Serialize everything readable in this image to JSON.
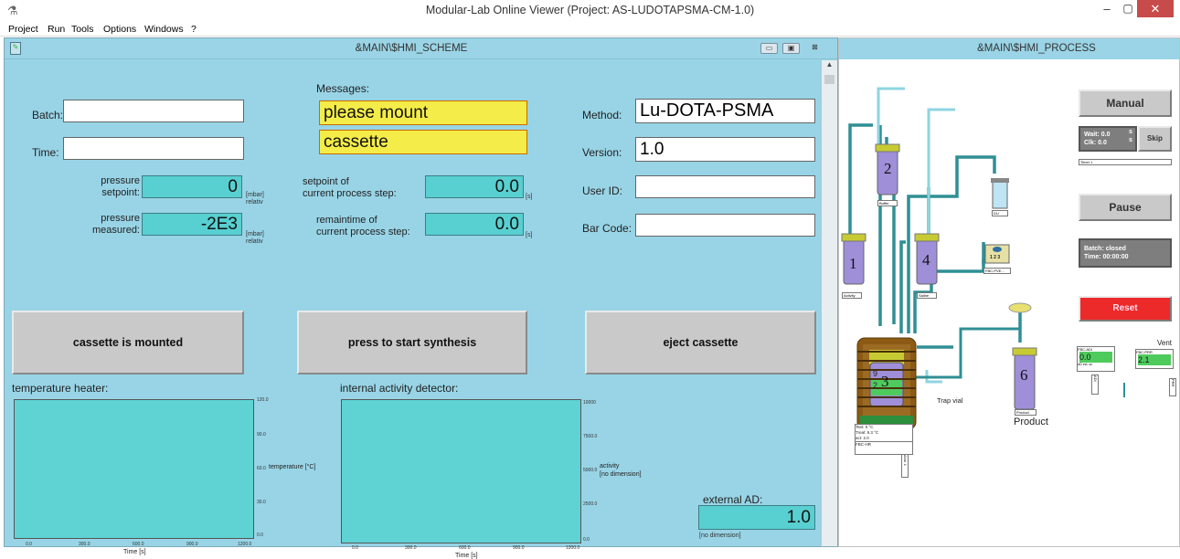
{
  "window": {
    "title": "Modular-Lab Online Viewer   (Project: AS-LUDOTAPSMA-CM-1.0)",
    "close": "✕",
    "minimize": "‒",
    "maximize": "▢"
  },
  "menu": [
    "Project",
    "Run",
    "Tools",
    "Options",
    "Windows",
    "?"
  ],
  "scheme": {
    "title": "&MAIN\\$HMI_SCHEME",
    "batch_label": "Batch:",
    "batch_value": "",
    "time_label": "Time:",
    "time_value": "",
    "messages_label": "Messages:",
    "message_line1": "please mount",
    "message_line2": "cassette",
    "method_label": "Method:",
    "method_value": "Lu-DOTA-PSMA",
    "version_label": "Version:",
    "version_value": "1.0",
    "userid_label": "User ID:",
    "userid_value": "",
    "barcode_label": "Bar Code:",
    "barcode_value": "",
    "pressure_setpoint_label1": "pressure",
    "pressure_setpoint_label2": "setpoint:",
    "pressure_setpoint_value": "0",
    "pressure_measured_label1": "pressure",
    "pressure_measured_label2": "measured:",
    "pressure_measured_value": "-2E3",
    "unit_mbar": "[mbar]",
    "unit_relativ": "relativ",
    "setpoint_step_label1": "setpoint of",
    "setpoint_step_label2": "current process step:",
    "setpoint_step_value": "0.0",
    "remaintime_label1": "remaintime of",
    "remaintime_label2": "current process step:",
    "remaintime_value": "0.0",
    "unit_s": "[s]",
    "btn_mounted": "cassette is mounted",
    "btn_start": "press to start synthesis",
    "btn_eject": "eject cassette",
    "heater_title": "temperature heater:",
    "heater_ylabel": "temperature [°C]",
    "heater_xlabel": "Time [s]",
    "heater_yticks": [
      "120.0",
      "90.0",
      "60.0",
      "30.0",
      "0.0"
    ],
    "heater_xticks": [
      "0.0",
      "300.0",
      "600.0",
      "900.0",
      "1200.0"
    ],
    "activity_title": "internal activity detector:",
    "activity_ylabel1": "activity",
    "activity_ylabel2": "[no dimension]",
    "activity_xlabel": "Time [s]",
    "activity_yticks": [
      "10000",
      "7500.0",
      "5000.0",
      "2500.0",
      "0.0"
    ],
    "activity_xticks": [
      "0.0",
      "300.0",
      "600.0",
      "900.0",
      "1200.0"
    ],
    "external_ad_label": "external AD:",
    "external_ad_value": "1.0",
    "external_ad_unit": "[no dimension]"
  },
  "process": {
    "title": "&MAIN\\$HMI_PROCESS",
    "btn_manual": "Manual",
    "wait_label": "Wait: 0.0",
    "wait_unit": "s",
    "clk_label": "Clk:  0.0",
    "clk_unit": "s",
    "btn_skip": "Skip",
    "timer_tag": "Timer 1",
    "btn_pause": "Pause",
    "batch_status": "Batch:  closed",
    "time_status": "Time:  00:00:00",
    "btn_reset": "Reset",
    "vent_label": "Vent",
    "adi_tag": "FBC-ADI",
    "adi_value": "0.0",
    "adi_sub": "AD ext. sc.",
    "prr_tag": "FBC-PRR",
    "prr_value": "2.1",
    "vial1": "1",
    "vial1_tag": "Activity",
    "vial2": "2",
    "vial2_tag": "Buffer",
    "vial3": "3",
    "vial4": "4",
    "vial4_tag": "Saline",
    "vial6": "6",
    "vial6_tag": "Product",
    "product_label": "Product",
    "trap_label": "Trap vial",
    "col_tag": "DU",
    "pump_tag": "FBC-PVE...",
    "pump_text": "1 2 3",
    "reactor_t1": "Tset:    0         °C",
    "reactor_t2": "Treal:   9.3      °C",
    "reactor_t3": "act:     2.0",
    "reactor_tag": "FBC-HR",
    "vert_tag1": "Actv. 1",
    "vert_tag2": "ADI",
    "vert_tag3": "PRR",
    "reactor_marks": [
      "9",
      "2"
    ]
  },
  "colors": {
    "panel_bg": "#98d4e6",
    "message_bg": "#f4ec48",
    "value_bg": "#58cfd0",
    "reset_bg": "#ec2a2a",
    "tubing": "#2f8f94"
  }
}
